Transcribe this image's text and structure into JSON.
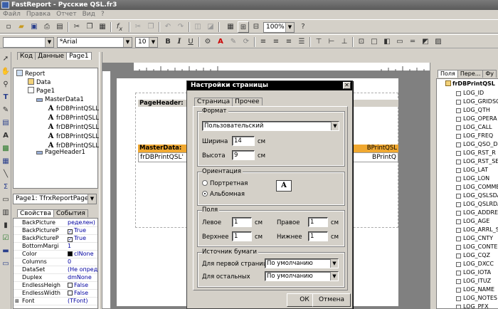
{
  "app": {
    "title": "FastReport - Русские QSL.fr3"
  },
  "menu": [
    "Файл",
    "Правка",
    "Отчет",
    "Вид",
    "?"
  ],
  "toolbar": {
    "zoom": "100%",
    "font_name": "Arial",
    "font_size": "10",
    "bold": "B",
    "italic": "I",
    "underline": "U"
  },
  "doc_tabs": [
    "Код",
    "Данные",
    "Page1"
  ],
  "tree": {
    "items": [
      "Report",
      "Data",
      "Page1",
      "MasterData1",
      "frDBPrintQSLLO",
      "frDBPrintQSLLO",
      "frDBPrintQSLLO",
      "frDBPrintQSLLO",
      "frDBPrintQSLLO",
      "PageHeader1"
    ]
  },
  "object_select": "Page1: TfrxReportPage",
  "inspector": {
    "tabs": [
      "Свойства",
      "События"
    ],
    "rows": [
      {
        "k": "BackPicture",
        "v": "ределен)"
      },
      {
        "k": "BackPictureP",
        "v": "True"
      },
      {
        "k": "BackPictureP",
        "v": "True"
      },
      {
        "k": "BottomMargi",
        "v": "1"
      },
      {
        "k": "Color",
        "v": "clNone"
      },
      {
        "k": "Columns",
        "v": "0"
      },
      {
        "k": "DataSet",
        "v": "(Не определе"
      },
      {
        "k": "Duplex",
        "v": "dmNone"
      },
      {
        "k": "EndlessHeigh",
        "v": "False"
      },
      {
        "k": "EndlessWidth",
        "v": "False"
      },
      {
        "k": "Font",
        "v": "(TFont)"
      }
    ]
  },
  "design": {
    "page_header": "PageHeader:",
    "masterdata": "MasterData:",
    "band_right": "BPrintQSL",
    "field_left": "frDBPrintQSL'",
    "field_right": "BPrintQ"
  },
  "right_panel": {
    "tabs": [
      "Поля",
      "Пере...",
      "Фу"
    ],
    "root": "frDBPrintQSL",
    "fields": [
      "LOG_ID",
      "LOG_GRIDSQ",
      "LOG_QTH",
      "LOG_OPERA",
      "LOG_CALL",
      "LOG_FREQ",
      "LOG_QSO_D",
      "LOG_RST_R",
      "LOG_RST_SE",
      "LOG_LAT",
      "LOG_LON",
      "LOG_COMME",
      "LOG_QSLSDA",
      "LOG_QSLRDA",
      "LOG_ADDRE",
      "LOG_AGE",
      "LOG_ARRL_S",
      "LOG_CNTY",
      "LOG_CONTE",
      "LOG_CQZ",
      "LOG_DXCC",
      "LOG_IOTA",
      "LOG_ITUZ",
      "LOG_NAME",
      "LOG_NOTES",
      "LOG_PFX"
    ]
  },
  "dialog": {
    "title": "Настройки страницы",
    "tabs": [
      "Страница",
      "Прочее"
    ],
    "format": {
      "label": "Формат",
      "value": "Пользовательский",
      "width_label": "Ширина",
      "width": "14",
      "height_label": "Высота",
      "height": "9",
      "unit": "см"
    },
    "orientation": {
      "label": "Ориентация",
      "portrait": "Портретная",
      "landscape": "Альбомная",
      "selected": "landscape",
      "preview_letter": "A"
    },
    "margins": {
      "label": "Поля",
      "left_label": "Левое",
      "left": "1",
      "right_label": "Правое",
      "right": "1",
      "top_label": "Верхнее",
      "top": "1",
      "bottom_label": "Нижнее",
      "bottom": "1",
      "unit": "см"
    },
    "paper": {
      "label": "Источник бумаги",
      "first_label": "Для первой страницы",
      "first": "По умолчанию",
      "other_label": "Для остальных",
      "other": "По умолчанию"
    },
    "ok": "ОК",
    "cancel": "Отмена"
  }
}
